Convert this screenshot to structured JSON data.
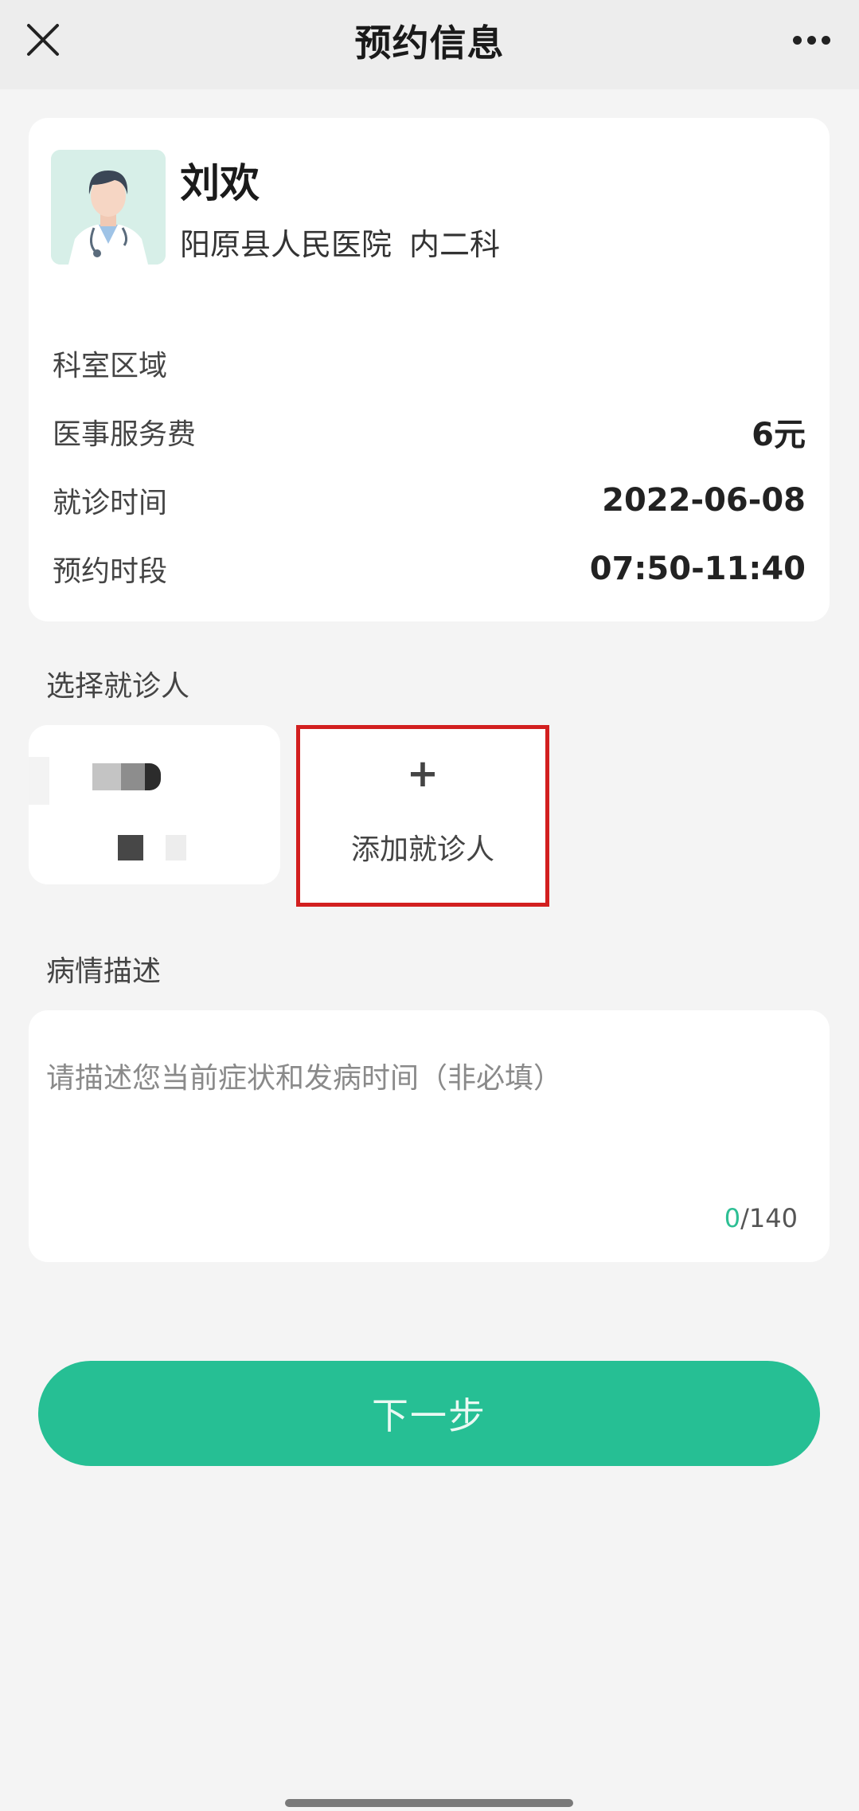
{
  "header": {
    "title": "预约信息"
  },
  "doctor": {
    "name": "刘欢",
    "hospital": "阳原县人民医院",
    "department": "内二科"
  },
  "info_rows": [
    {
      "label": "科室区域",
      "value": ""
    },
    {
      "label": "医事服务费",
      "value": "6元"
    },
    {
      "label": "就诊时间",
      "value": "2022-06-08"
    },
    {
      "label": "预约时段",
      "value": "07:50-11:40"
    }
  ],
  "patients": {
    "section_title": "选择就诊人",
    "add_label": "添加就诊人",
    "add_symbol": "+"
  },
  "description": {
    "section_title": "病情描述",
    "placeholder": "请描述您当前症状和发病时间（非必填）",
    "count_current": "0",
    "count_max": "/140"
  },
  "actions": {
    "next_label": "下一步"
  },
  "colors": {
    "accent": "#26bf94",
    "highlight_border": "#d21f1f",
    "background": "#f4f4f4"
  }
}
